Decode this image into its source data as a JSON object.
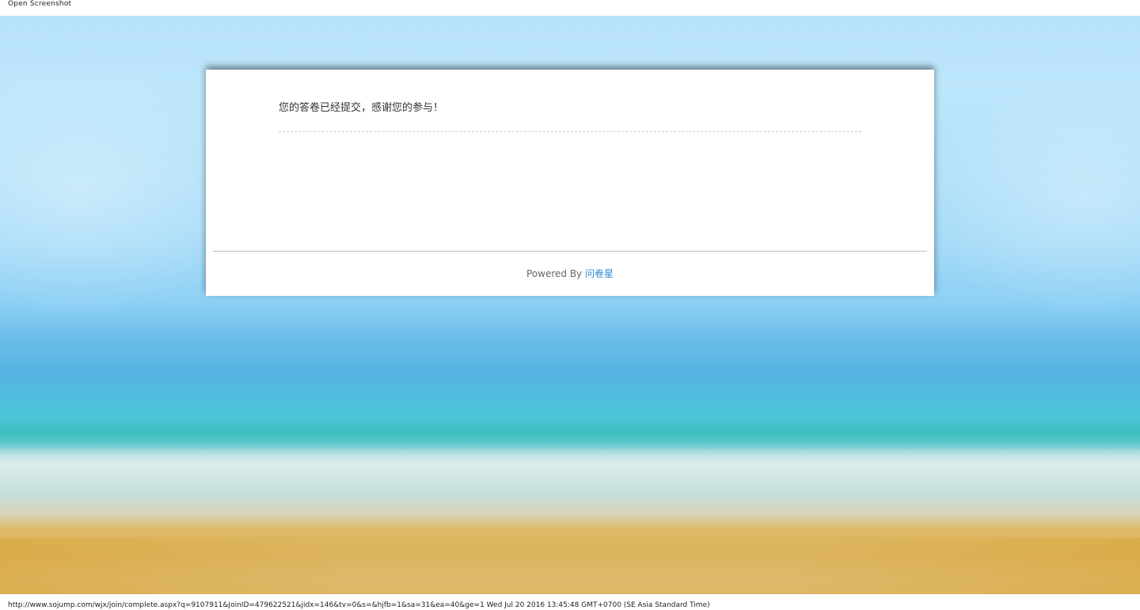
{
  "toolbar": {
    "open_label": "Open Screenshot"
  },
  "card": {
    "message": "您的答卷已经提交，感谢您的参与！",
    "powered_prefix": "Powered By",
    "brand_name": "问卷星"
  },
  "status": {
    "url": "http://www.sojump.com/wjx/join/complete.aspx?q=9107911&JoinID=479622521&jidx=146&tv=0&s=&hjfb=1&sa=31&ea=40&ge=1",
    "timestamp": "Wed Jul 20 2016 13:45:48 GMT+0700 (SE Asia Standard Time)"
  },
  "colors": {
    "link": "#2b8bd0",
    "text": "#333333",
    "card_background": "#ffffff"
  }
}
